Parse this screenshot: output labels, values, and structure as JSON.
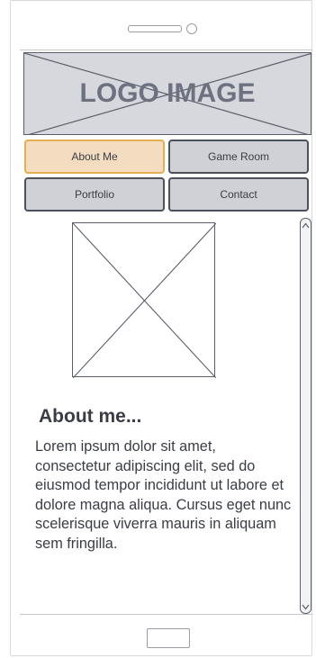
{
  "logo": {
    "text": "LOGO IMAGE"
  },
  "nav": {
    "items": [
      {
        "label": "About Me",
        "active": true
      },
      {
        "label": "Game Room",
        "active": false
      },
      {
        "label": "Portfolio",
        "active": false
      },
      {
        "label": "Contact",
        "active": false
      }
    ]
  },
  "content": {
    "heading": "About me...",
    "body": "Lorem ipsum dolor sit amet, consectetur adipiscing elit, sed do eiusmod tempor incididunt ut labore et dolore magna aliqua. Cursus eget nunc scelerisque viverra mauris in aliquam sem fringilla."
  },
  "colors": {
    "active_fill": "#f4dcc0",
    "active_border": "#e6ad53",
    "button_fill": "#cfd1d7",
    "logo_fill": "#d6d8dd",
    "text": "#3a3d45"
  },
  "icons": {
    "scroll_up": "chevron-up-icon",
    "scroll_down": "chevron-down-icon"
  }
}
